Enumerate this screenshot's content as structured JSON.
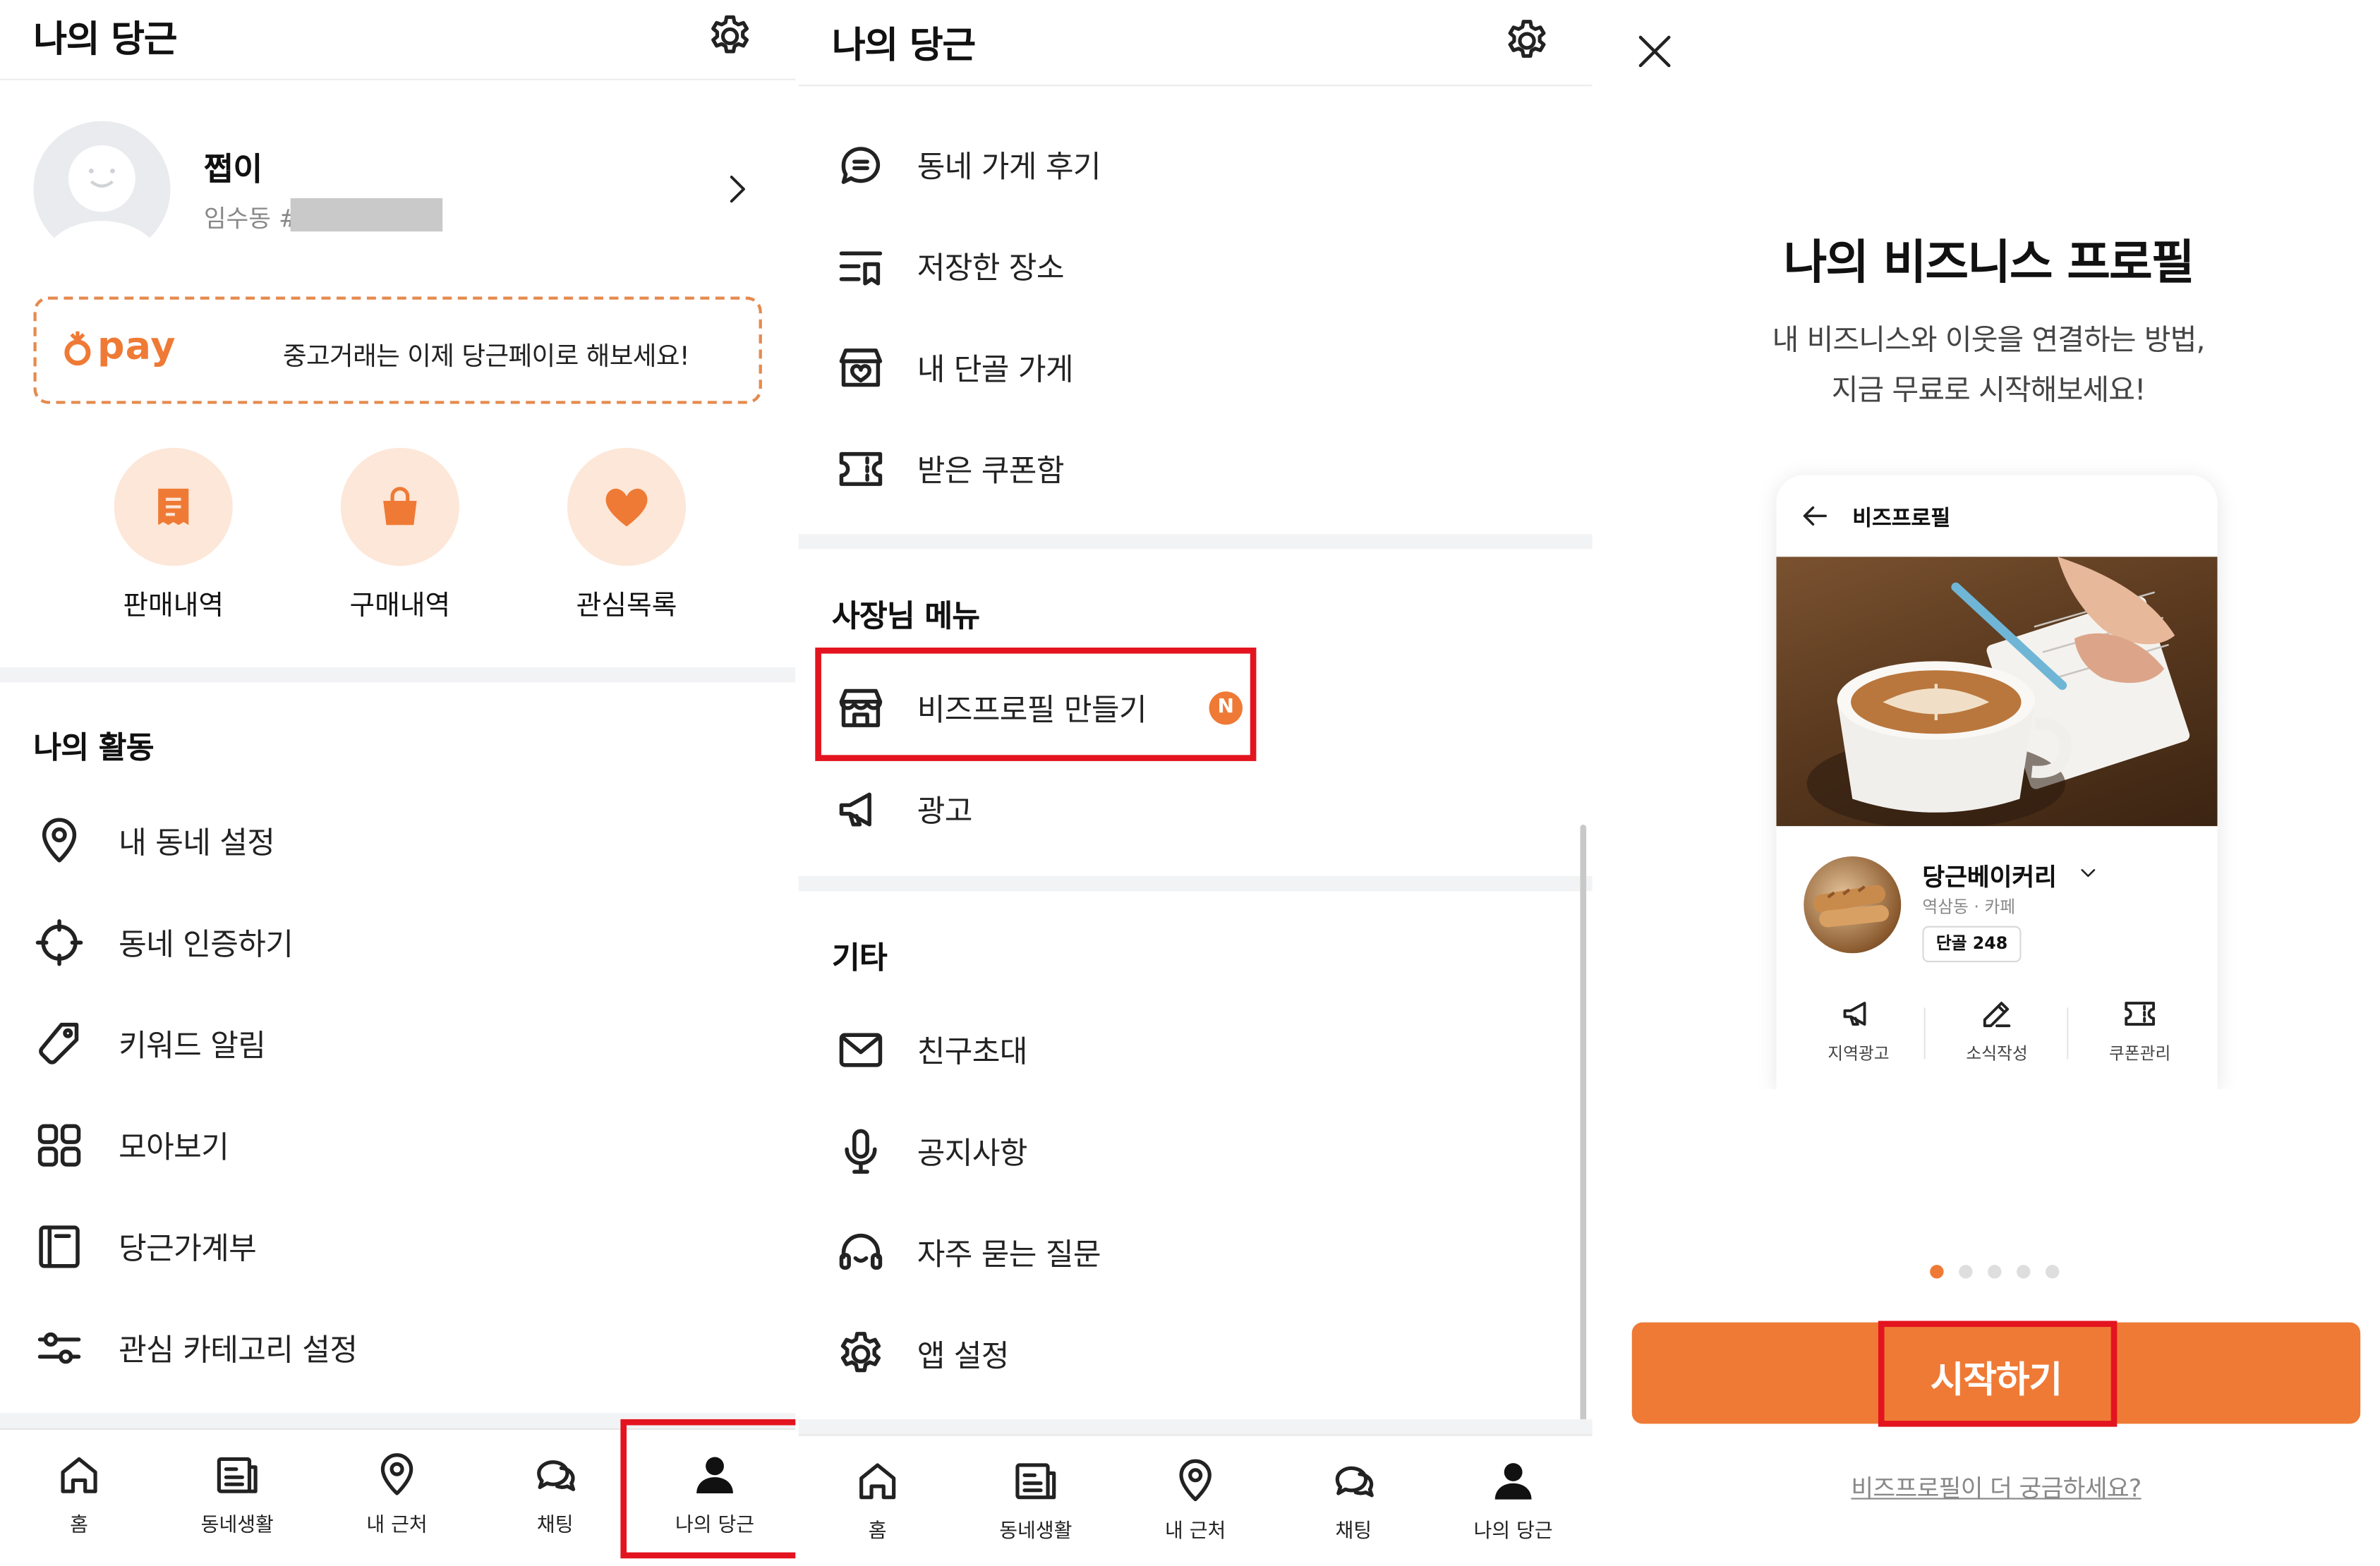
{
  "panel1": {
    "title": "나의 당근",
    "profile": {
      "name": "쩝이",
      "location": "임수동 #"
    },
    "pay": {
      "brand": "pay",
      "message": "중고거래는 이제 당근페이로 해보세요!"
    },
    "quick": [
      {
        "label": "판매내역",
        "icon": "receipt-icon"
      },
      {
        "label": "구매내역",
        "icon": "shopping-bag-icon"
      },
      {
        "label": "관심목록",
        "icon": "heart-icon"
      }
    ],
    "activity_title": "나의 활동",
    "activity": [
      {
        "label": "내 동네 설정",
        "icon": "location-pin-icon"
      },
      {
        "label": "동네 인증하기",
        "icon": "crosshair-icon"
      },
      {
        "label": "키워드 알림",
        "icon": "tag-icon"
      },
      {
        "label": "모아보기",
        "icon": "grid-icon"
      },
      {
        "label": "당근가계부",
        "icon": "ledger-icon"
      },
      {
        "label": "관심 카테고리 설정",
        "icon": "sliders-icon"
      }
    ],
    "nav": [
      "홈",
      "동네생활",
      "내 근처",
      "채팅",
      "나의 당근"
    ]
  },
  "panel2": {
    "title": "나의 당근",
    "items": [
      {
        "label": "동네 가게 후기",
        "icon": "chat-bubble-icon"
      },
      {
        "label": "저장한 장소",
        "icon": "saved-list-icon"
      },
      {
        "label": "내 단골 가게",
        "icon": "store-heart-icon"
      },
      {
        "label": "받은 쿠폰함",
        "icon": "coupon-icon"
      }
    ],
    "owner_title": "사장님 메뉴",
    "owner_items": [
      {
        "label": "비즈프로필 만들기",
        "icon": "store-icon",
        "badge": "N"
      },
      {
        "label": "광고",
        "icon": "megaphone-icon"
      }
    ],
    "etc_title": "기타",
    "etc_items": [
      {
        "label": "친구초대",
        "icon": "mail-icon"
      },
      {
        "label": "공지사항",
        "icon": "microphone-icon"
      },
      {
        "label": "자주 묻는 질문",
        "icon": "headset-icon"
      },
      {
        "label": "앱 설정",
        "icon": "gear-icon"
      }
    ],
    "nav": [
      "홈",
      "동네생활",
      "내 근처",
      "채팅",
      "나의 당근"
    ]
  },
  "panel3": {
    "title": "나의 비즈니스 프로필",
    "subtitle_line1": "내 비즈니스와 이웃을 연결하는 방법,",
    "subtitle_line2": "지금 무료로 시작해보세요!",
    "mock": {
      "header": "비즈프로필",
      "store_name": "당근베이커리",
      "store_meta": "역삼동 · 카페",
      "regulars": "단골 248",
      "actions": [
        "지역광고",
        "소식작성",
        "쿠폰관리"
      ]
    },
    "pagination_total": 5,
    "pagination_active": 1,
    "start_button": "시작하기",
    "more_link": "비즈프로필이 더 궁금하세요?"
  },
  "colors": {
    "accent": "#ef7a35",
    "highlight": "#e3141f",
    "pay_dashed": "#e58a4e"
  }
}
